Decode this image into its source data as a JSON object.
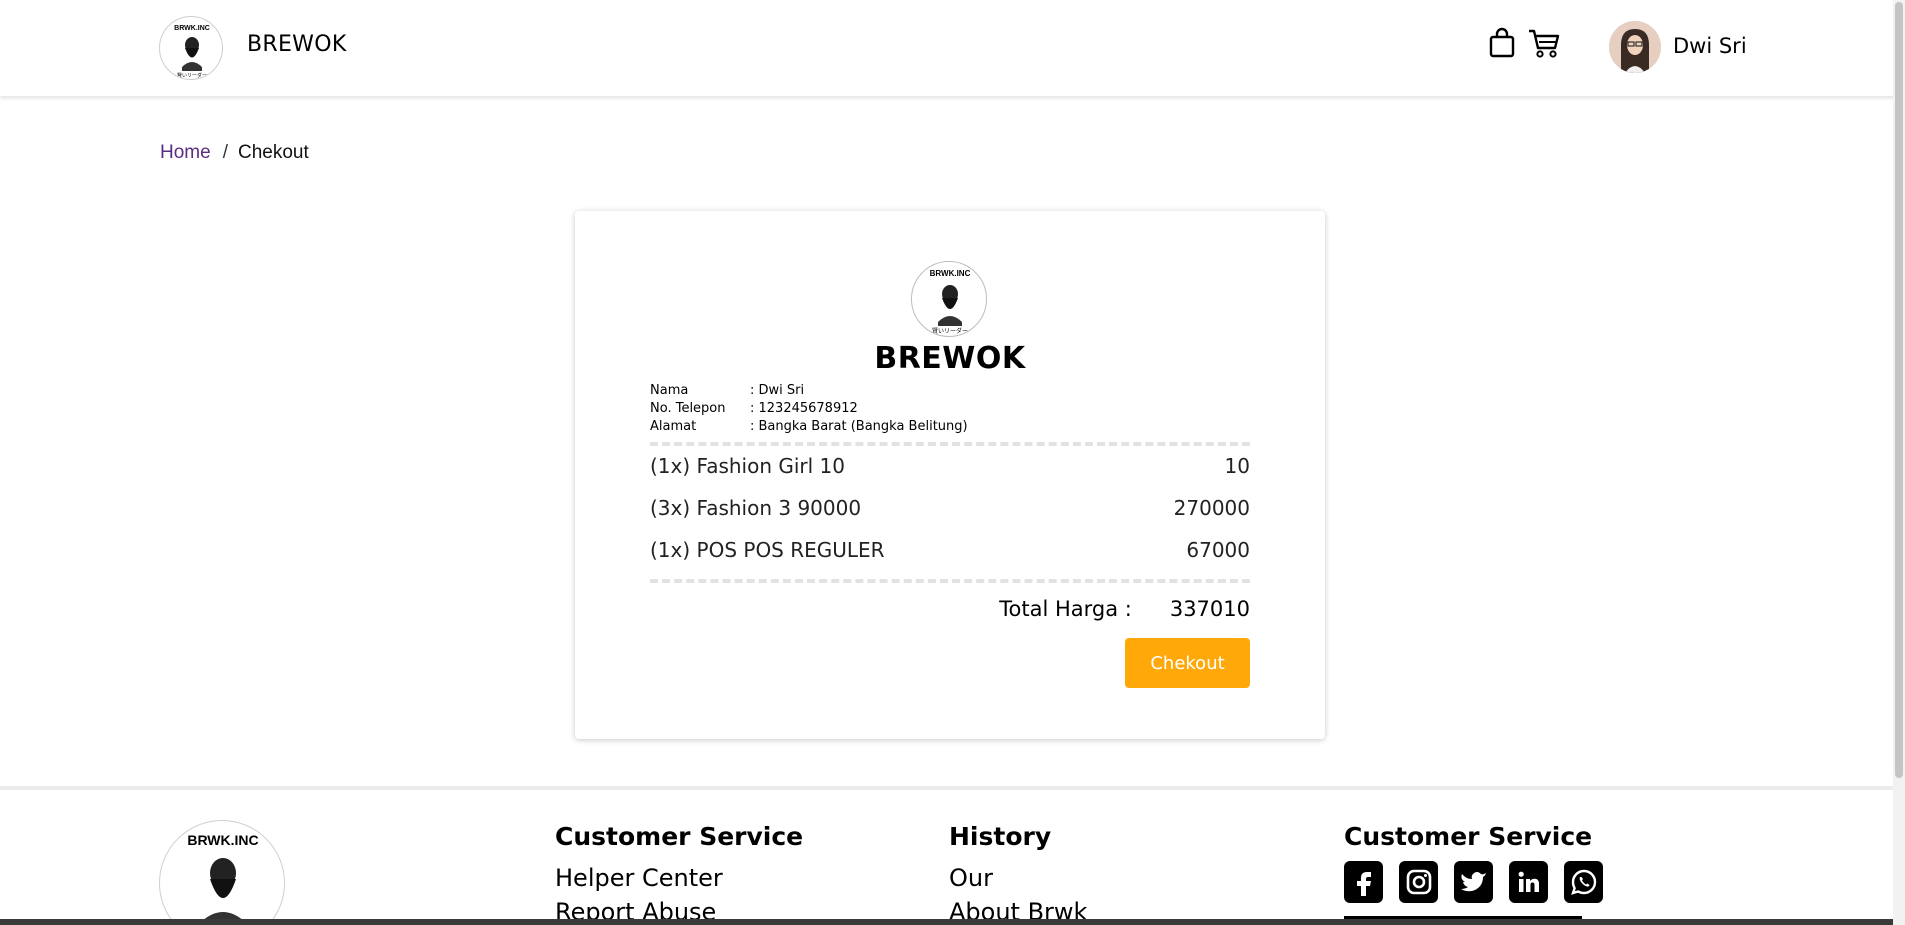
{
  "header": {
    "brand": "BREWOK",
    "logo_text": "BRWK.INC",
    "logo_sub": "賢いリーダー",
    "user_name": "Dwi Sri",
    "icons": [
      "shopping-bag-icon",
      "cart-icon"
    ]
  },
  "breadcrumb": {
    "home": "Home",
    "separator": "/",
    "current": "Chekout"
  },
  "receipt": {
    "title": "BREWOK",
    "info": [
      {
        "label": "Nama",
        "value": ": Dwi Sri"
      },
      {
        "label": "No. Telepon",
        "value": ": 123245678912"
      },
      {
        "label": "Alamat",
        "value": ": Bangka Barat (Bangka Belitung)"
      }
    ],
    "items": [
      {
        "name": "(1x) Fashion Girl 10",
        "price": "10"
      },
      {
        "name": "(3x) Fashion 3 90000",
        "price": "270000"
      },
      {
        "name": "(1x) POS POS REGULER",
        "price": "67000"
      }
    ],
    "total_label": "Total Harga :",
    "total_value": "337010",
    "checkout_label": "Chekout",
    "button_color": "#ffa80a"
  },
  "footer": {
    "col1": {
      "heading": "Customer Service",
      "links": [
        "Helper Center",
        "Report Abuse"
      ]
    },
    "col2": {
      "heading": "History",
      "links": [
        "Our",
        "About Brwk"
      ]
    },
    "col3": {
      "heading": "Customer Service",
      "socials": [
        "facebook-icon",
        "instagram-icon",
        "twitter-icon",
        "linkedin-icon",
        "whatsapp-icon"
      ]
    }
  }
}
